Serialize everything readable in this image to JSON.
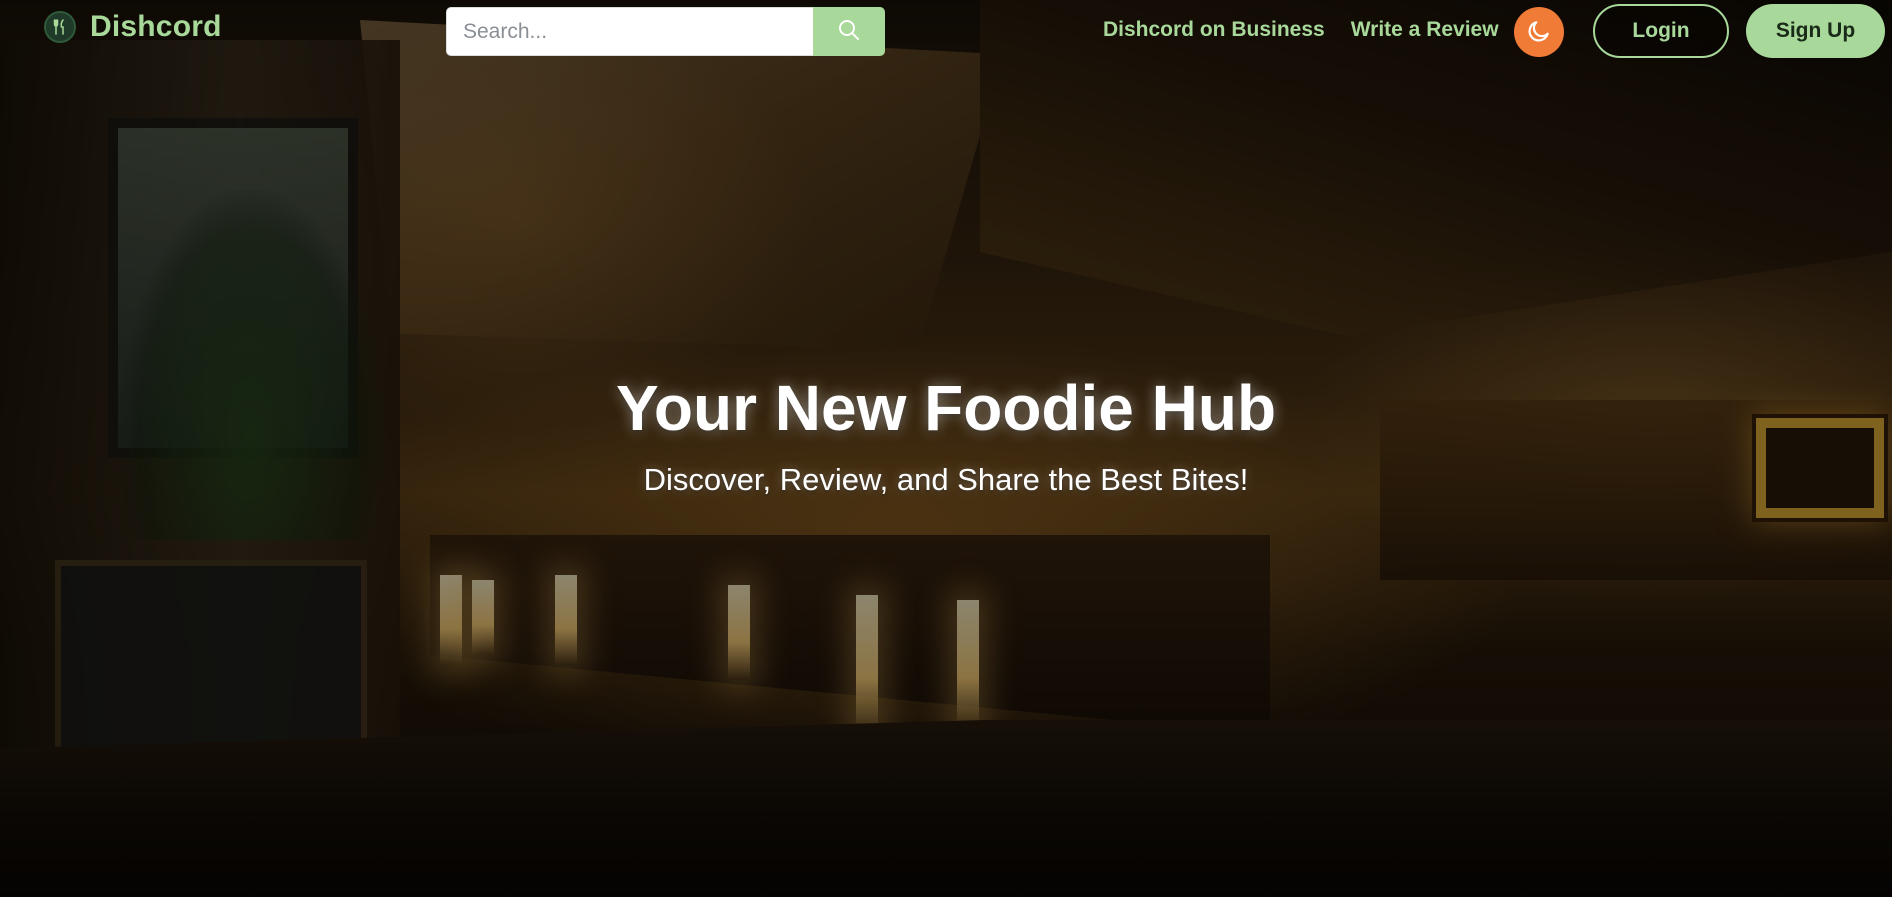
{
  "brand": {
    "name": "Dishcord",
    "logo_icon": "fork-knife-icon",
    "accent_color": "#a8d89a",
    "theme_toggle_color": "#f07b37"
  },
  "search": {
    "placeholder": "Search...",
    "value": "",
    "button_icon": "search-icon"
  },
  "nav": {
    "links": [
      {
        "label": "Dishcord on Business"
      },
      {
        "label": "Write a Review"
      }
    ],
    "theme_toggle_icon": "moon-icon",
    "login_label": "Login",
    "signup_label": "Sign Up"
  },
  "hero": {
    "title": "Your New Foodie Hub",
    "subtitle": "Discover, Review, and Share the Best Bites!"
  }
}
